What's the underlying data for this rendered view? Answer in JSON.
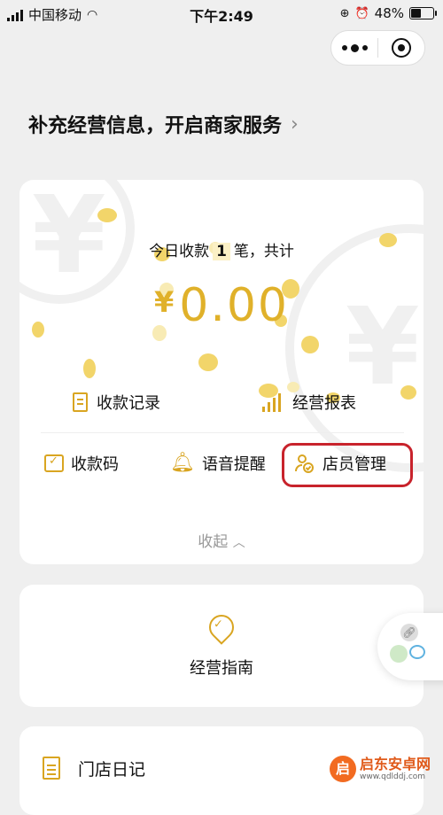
{
  "status_bar": {
    "carrier": "中国移动",
    "time": "下午2:49",
    "battery": "48%",
    "battery_level": 0.48
  },
  "header": {
    "title": "补充经营信息，开启商家服务",
    "chevron": "›"
  },
  "summary": {
    "today_prefix": "今日收款",
    "today_count": "1",
    "today_suffix": "笔，共计",
    "currency": "¥",
    "amount": "0.00"
  },
  "actions_row1": [
    {
      "label": "收款记录",
      "icon": "document-icon"
    },
    {
      "label": "经营报表",
      "icon": "bar-chart-icon"
    }
  ],
  "actions_row2": [
    {
      "label": "收款码",
      "icon": "qr-code-icon"
    },
    {
      "label": "语音提醒",
      "icon": "bell-icon"
    },
    {
      "label": "店员管理",
      "icon": "staff-icon"
    }
  ],
  "collapse_label": "收起",
  "guide": {
    "label": "经营指南",
    "icon": "location-check-icon"
  },
  "diary": {
    "label": "门店日记",
    "icon": "notebook-icon"
  },
  "watermark": {
    "title": "启东安卓网",
    "url": "www.qdlddj.com"
  },
  "colors": {
    "accent": "#e0b12a",
    "highlight": "#c8232c",
    "background": "#efefef"
  }
}
